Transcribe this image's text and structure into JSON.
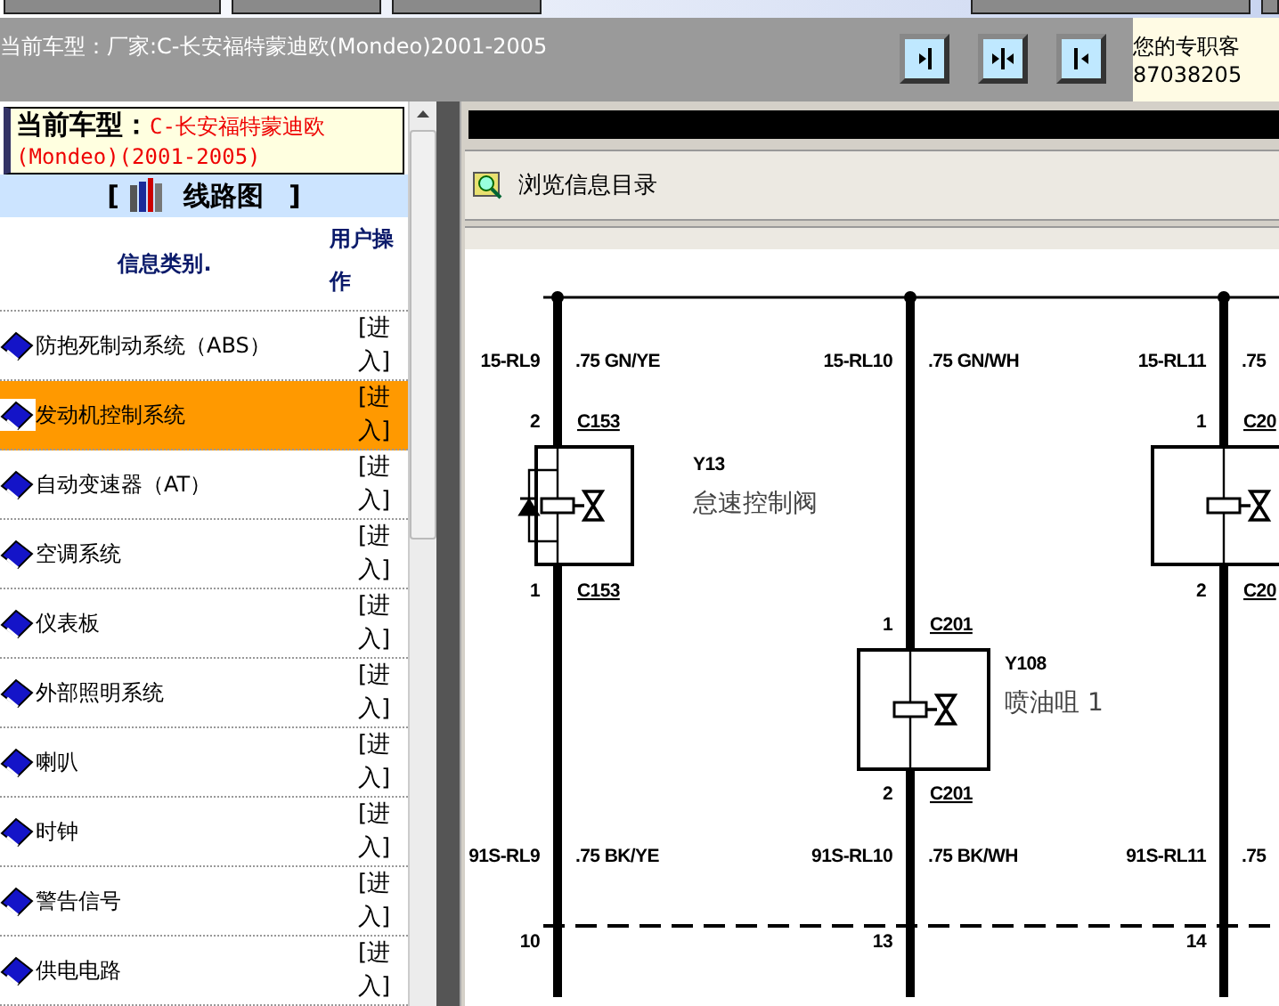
{
  "header": {
    "vehicle_info": "当前车型：厂家:C-长安福特蒙迪欧(Mondeo)2001-2005",
    "service_lines": [
      "您的专职客",
      "87038205"
    ]
  },
  "sidebar": {
    "vehicle_label": "当前车型：",
    "vehicle_value": "C-长安福特蒙迪欧(Mondeo)(2001-2005)",
    "section_open": "[",
    "section_title": "线路图",
    "section_close": "]",
    "columns": [
      "信息类别.",
      "用户操作"
    ],
    "items": [
      {
        "label": "防抱死制动系统（ABS）",
        "action": "[进入]",
        "selected": false
      },
      {
        "label": "发动机控制系统",
        "action": "[进入]",
        "selected": true
      },
      {
        "label": "自动变速器（AT）",
        "action": "[进入]",
        "selected": false
      },
      {
        "label": "空调系统",
        "action": "[进入]",
        "selected": false
      },
      {
        "label": "仪表板",
        "action": "[进入]",
        "selected": false
      },
      {
        "label": "外部照明系统",
        "action": "[进入]",
        "selected": false
      },
      {
        "label": "喇叭",
        "action": "[进入]",
        "selected": false
      },
      {
        "label": "时钟",
        "action": "[进入]",
        "selected": false
      },
      {
        "label": "警告信号",
        "action": "[进入]",
        "selected": false
      },
      {
        "label": "供电电路",
        "action": "[进入]",
        "selected": false
      }
    ]
  },
  "content": {
    "toolbar_label": "浏览信息目录",
    "diagram": {
      "columns": [
        {
          "circuit_top": "15-RL9",
          "wire_top": ".75 GN/YE",
          "pin_in": "2",
          "conn_in": "C153",
          "component": {
            "ref": "Y13",
            "name": "怠速控制阀",
            "kind": "diode-valve"
          },
          "pin_out": "1",
          "conn_out": "C153",
          "circuit_bottom": "91S-RL9",
          "wire_bottom": ".75 BK/YE",
          "splice_pin": "10"
        },
        {
          "circuit_top": "15-RL10",
          "wire_top": ".75 GN/WH",
          "pin_in": "1",
          "conn_in": "C201",
          "component": {
            "ref": "Y108",
            "name": "喷油咀 1",
            "kind": "valve"
          },
          "pin_out": "2",
          "conn_out": "C201",
          "circuit_bottom": "91S-RL10",
          "wire_bottom": ".75 BK/WH",
          "splice_pin": "13"
        },
        {
          "circuit_top": "15-RL11",
          "wire_top": ".75",
          "pin_in": "1",
          "conn_in": "C20",
          "component": {
            "kind": "valve"
          },
          "pin_out": "2",
          "conn_out": "C20",
          "circuit_bottom": "91S-RL11",
          "wire_bottom": ".75",
          "splice_pin": "14"
        }
      ]
    }
  }
}
